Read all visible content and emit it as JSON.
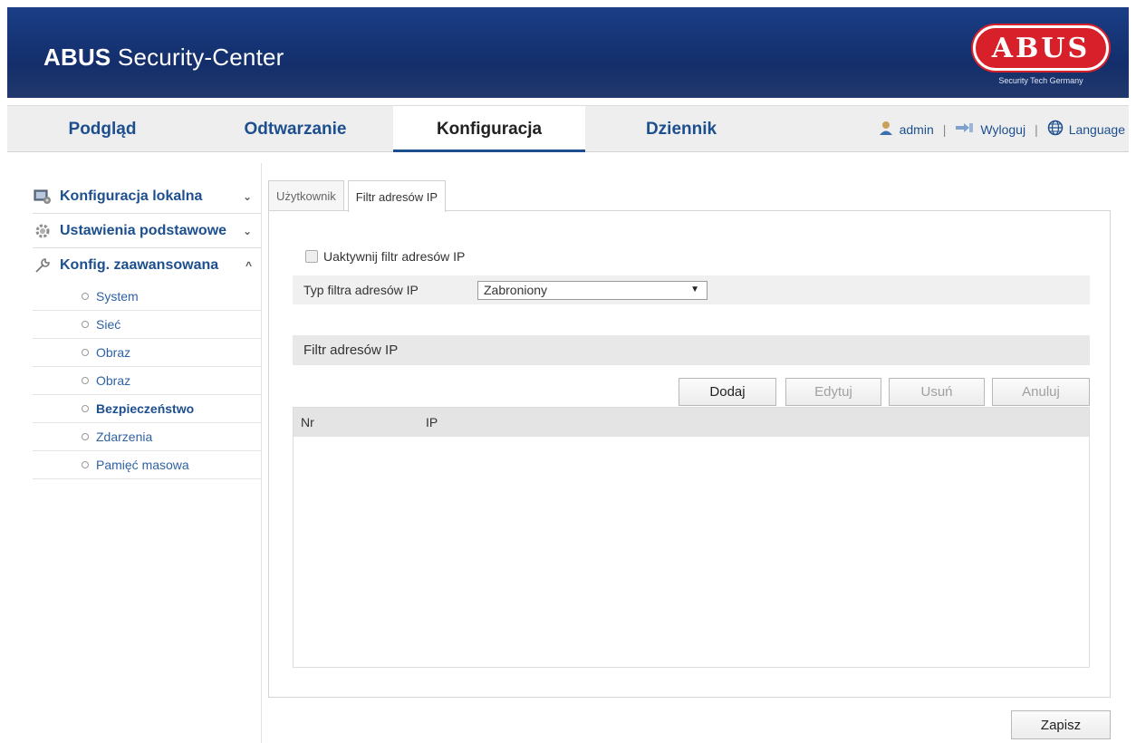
{
  "header": {
    "brand_bold": "ABUS",
    "brand_rest": " Security-Center",
    "logo_text": "ABUS",
    "logo_tagline": "Security Tech Germany",
    "logo_color": "#d8202a"
  },
  "nav": {
    "tabs": [
      {
        "label": "Podgląd"
      },
      {
        "label": "Odtwarzanie"
      },
      {
        "label": "Konfiguracja"
      },
      {
        "label": "Dziennik"
      }
    ],
    "active_tab": "Konfiguracja",
    "user": "admin",
    "logout": "Wyloguj",
    "language": "Language",
    "separator": "|"
  },
  "sidebar": {
    "groups": [
      {
        "label": "Konfiguracja lokalna",
        "icon": "monitor-icon",
        "chevron": "⌄"
      },
      {
        "label": "Ustawienia podstawowe",
        "icon": "gear-icon",
        "chevron": "⌄"
      },
      {
        "label": "Konfig. zaawansowana",
        "icon": "wrench-icon",
        "chevron": "^"
      }
    ],
    "items": [
      {
        "label": "System"
      },
      {
        "label": "Sieć"
      },
      {
        "label": "Obraz"
      },
      {
        "label": "Obraz"
      },
      {
        "label": "Bezpieczeństwo"
      },
      {
        "label": "Zdarzenia"
      },
      {
        "label": "Pamięć masowa"
      }
    ],
    "active_item": "Bezpieczeństwo"
  },
  "subtabs": [
    {
      "label": "Użytkownik"
    },
    {
      "label": "Filtr adresów IP"
    }
  ],
  "form": {
    "enable_label": "Uaktywnij filtr adresów IP",
    "type_label": "Typ filtra adresów IP",
    "type_value": "Zabroniony",
    "arrow": "▼"
  },
  "section": {
    "title": "Filtr adresów IP"
  },
  "buttons": {
    "add": "Dodaj",
    "edit": "Edytuj",
    "delete": "Usuń",
    "cancel": "Anuluj",
    "save": "Zapisz"
  },
  "table": {
    "columns": [
      "Nr",
      "IP"
    ]
  }
}
